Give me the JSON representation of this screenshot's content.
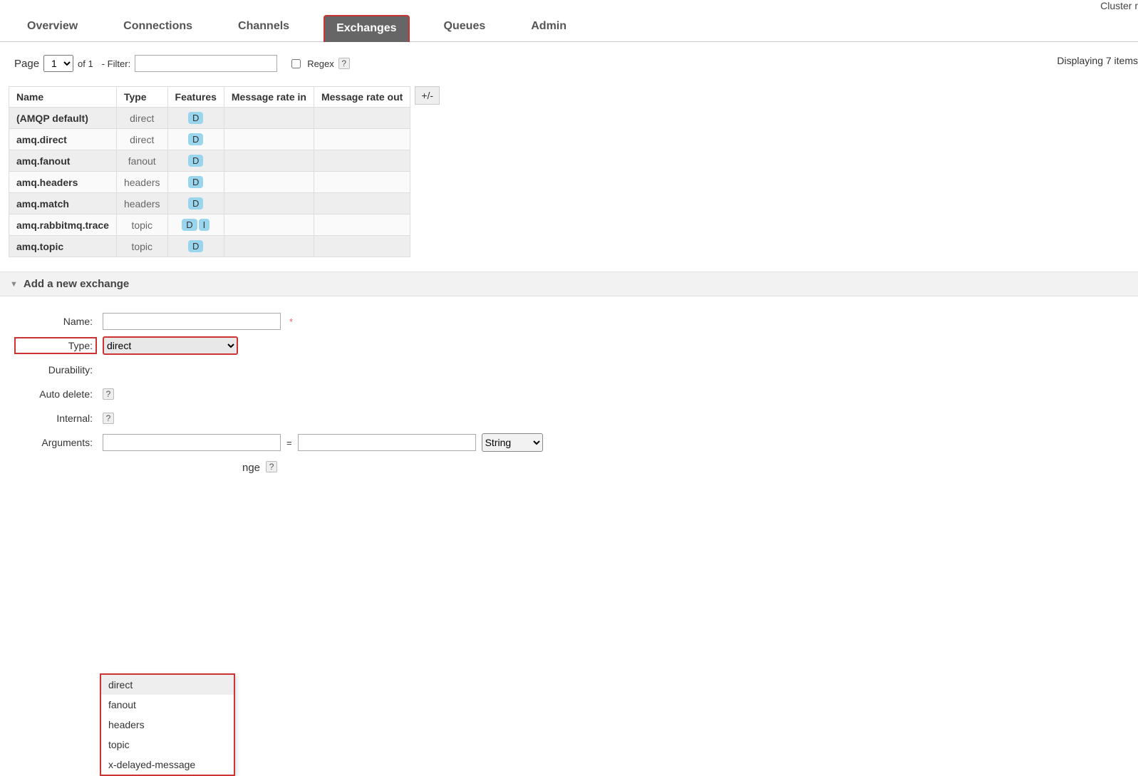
{
  "cluster_label": "Cluster r",
  "tabs": [
    "Overview",
    "Connections",
    "Channels",
    "Exchanges",
    "Queues",
    "Admin"
  ],
  "active_tab": "Exchanges",
  "pager": {
    "page_label": "Page",
    "page_value": "1",
    "of_label": "of 1",
    "filter_label": "- Filter:",
    "regex_label": "Regex",
    "help": "?",
    "displaying": "Displaying 7 items"
  },
  "table": {
    "headers": [
      "Name",
      "Type",
      "Features",
      "Message rate in",
      "Message rate out"
    ],
    "plus_minus": "+/-",
    "rows": [
      {
        "name": "(AMQP default)",
        "type": "direct",
        "features": [
          "D"
        ],
        "rate_in": "",
        "rate_out": ""
      },
      {
        "name": "amq.direct",
        "type": "direct",
        "features": [
          "D"
        ],
        "rate_in": "",
        "rate_out": ""
      },
      {
        "name": "amq.fanout",
        "type": "fanout",
        "features": [
          "D"
        ],
        "rate_in": "",
        "rate_out": ""
      },
      {
        "name": "amq.headers",
        "type": "headers",
        "features": [
          "D"
        ],
        "rate_in": "",
        "rate_out": ""
      },
      {
        "name": "amq.match",
        "type": "headers",
        "features": [
          "D"
        ],
        "rate_in": "",
        "rate_out": ""
      },
      {
        "name": "amq.rabbitmq.trace",
        "type": "topic",
        "features": [
          "D",
          "I"
        ],
        "rate_in": "",
        "rate_out": ""
      },
      {
        "name": "amq.topic",
        "type": "topic",
        "features": [
          "D"
        ],
        "rate_in": "",
        "rate_out": ""
      }
    ]
  },
  "section": {
    "title": "Add a new exchange",
    "triangle": "▼"
  },
  "form": {
    "name_label": "Name:",
    "name_value": "",
    "required_mark": "*",
    "type_label": "Type:",
    "type_value": "direct",
    "type_options": [
      "direct",
      "fanout",
      "headers",
      "topic",
      "x-delayed-message"
    ],
    "durability_label": "Durability:",
    "autodelete_label": "Auto delete:",
    "internal_label": "Internal:",
    "arguments_label": "Arguments:",
    "arg_key": "",
    "arg_eq": "=",
    "arg_val": "",
    "arg_type": "String",
    "help": "?",
    "nge_tail": "nge"
  }
}
